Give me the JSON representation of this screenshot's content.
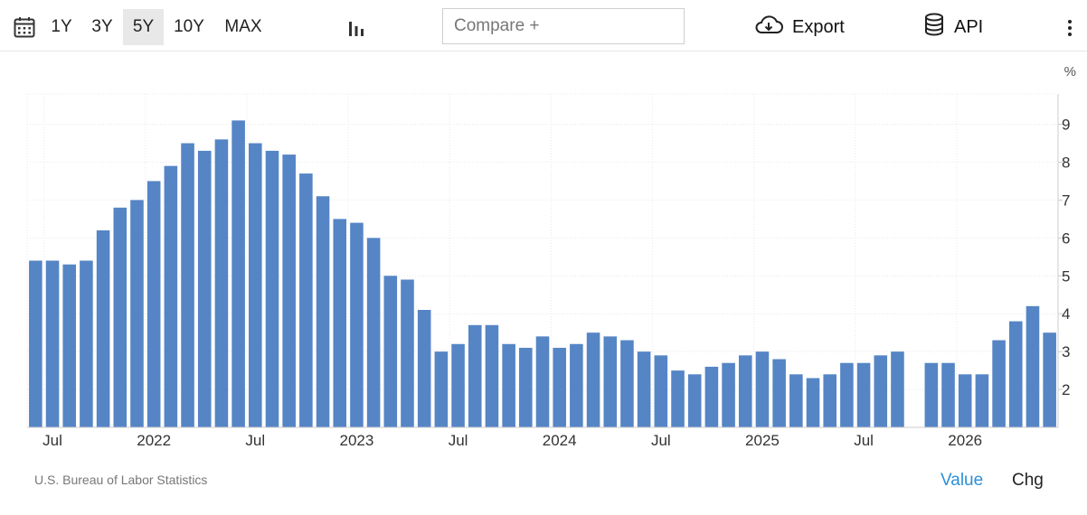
{
  "toolbar": {
    "ranges": [
      {
        "label": "1Y",
        "active": false
      },
      {
        "label": "3Y",
        "active": false
      },
      {
        "label": "5Y",
        "active": true
      },
      {
        "label": "10Y",
        "active": false
      },
      {
        "label": "MAX",
        "active": false
      }
    ],
    "compare_placeholder": "Compare +",
    "export_label": "Export",
    "api_label": "API",
    "icons": {
      "calendar": "calendar-icon",
      "chart_type": "bar-chart-icon",
      "export": "cloud-download-icon",
      "api": "database-icon",
      "more": "more-vertical-icon"
    }
  },
  "footer": {
    "source": "U.S. Bureau of Labor Statistics",
    "value_label": "Value",
    "chg_label": "Chg"
  },
  "colors": {
    "bar": "#5585c5",
    "active_toggle": "#2d8fd6",
    "grid": "#e9e9e9"
  },
  "chart_data": {
    "type": "bar",
    "unit": "%",
    "ylim": [
      1,
      9.8
    ],
    "yticks": [
      2,
      3,
      4,
      5,
      6,
      7,
      8,
      9
    ],
    "grid": true,
    "y_axis_side": "right",
    "x_ticks": [
      {
        "label": "Jul",
        "index": 1
      },
      {
        "label": "2022",
        "index": 7
      },
      {
        "label": "Jul",
        "index": 13
      },
      {
        "label": "2023",
        "index": 19
      },
      {
        "label": "Jul",
        "index": 25
      },
      {
        "label": "2024",
        "index": 31
      },
      {
        "label": "Jul",
        "index": 37
      },
      {
        "label": "2025",
        "index": 43
      },
      {
        "label": "Jul",
        "index": 49
      },
      {
        "label": "2026",
        "index": 55
      }
    ],
    "values": [
      5.4,
      5.4,
      5.3,
      5.4,
      6.2,
      6.8,
      7.0,
      7.5,
      7.9,
      8.5,
      8.3,
      8.6,
      9.1,
      8.5,
      8.3,
      8.2,
      7.7,
      7.1,
      6.5,
      6.4,
      6.0,
      5.0,
      4.9,
      4.1,
      3.0,
      3.2,
      3.7,
      3.7,
      3.2,
      3.1,
      3.4,
      3.1,
      3.2,
      3.5,
      3.4,
      3.3,
      3.0,
      2.9,
      2.5,
      2.4,
      2.6,
      2.7,
      2.9,
      3.0,
      2.8,
      2.4,
      2.3,
      2.4,
      2.7,
      2.7,
      2.9,
      3.0,
      null,
      2.7,
      2.7,
      2.4,
      2.4,
      3.3,
      3.8,
      4.2,
      3.5
    ]
  }
}
